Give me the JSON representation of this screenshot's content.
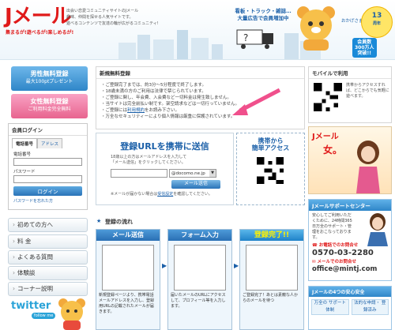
{
  "header": {
    "logo": "Jメール",
    "tagline": "集まるが!遊べるが!楽しめるが!",
    "intro": [
      "出会い恋愛コミュニティサイトのJメール",
      "趣味、仲間を探せる人気サイトです。",
      "遊べるコンテンツで友達の輪が広がるコミュニティ!"
    ],
    "truck_ad": [
      "看板・トラック・雑誌…",
      "大量広告で会員増加中"
    ],
    "badge_pre": "おかげさまで",
    "badge_years": "13",
    "badge_unit": "周年",
    "badge_users": [
      "会員数",
      "300万人",
      "突破!!"
    ]
  },
  "left": {
    "male": {
      "title": "男性無料登録",
      "sub": "最大100ptプレゼント"
    },
    "female": {
      "title": "女性無料登録",
      "sub": "ご利用料金完全無料"
    },
    "login": {
      "title": "会員ログイン",
      "tab_phone": "電話番号",
      "tab_address": "アドレス",
      "phone_label": "電話番号",
      "password_label": "パスワード",
      "button": "ログイン",
      "forgot": "パスワードを忘れた方"
    },
    "menu": [
      "初めての方へ",
      "料 金",
      "よくある質問",
      "体験談",
      "コーナー説明"
    ],
    "twitter": "twitter",
    "twitter_follow": "follow me"
  },
  "main": {
    "news_title": "新規無料登録",
    "news": [
      "・ご登録完了までは、約3分〜5分程度で終了します。",
      "・18歳未満の方のご利用は法律で禁じられています。",
      "・ご登録に関し、年会費、入会費など一切料金は発生致しません。",
      "・当サイトは完全前払い制です。架空請求などは一切行っていません。",
      "・ご登録には",
      "利用規約",
      "をお読み下さい。",
      "・万全なセキュリティーにより個人情報は厳重に保護されています。"
    ],
    "url_box": {
      "title": "登録URLを携帯に送信",
      "desc1": "18歳以上の方はメールアドレスを入力して",
      "desc2": "「メール送信」をクリックしてください。",
      "domain": "@docomo.ne.jp",
      "send": "メール送信",
      "note1": "※メールが届かない場合は",
      "note_link": "受信設定",
      "note2": "を確認してください。"
    },
    "mobile_access": [
      "携帯から",
      "簡単アクセス"
    ],
    "flow": {
      "title": "登録の流れ",
      "steps": [
        {
          "title": "メール送信",
          "text": "新規登録ページより、携帯電話メールアドレスを入力し、登録用URLの記載されたメールが届きます。"
        },
        {
          "title": "フォーム入力",
          "text": "届いたメールのURLにアクセスして、プロフィール等を入力します。"
        },
        {
          "title": "登録完了!!",
          "text": "ご登録完了！あとは素敵な人からのメールを待つ"
        }
      ]
    }
  },
  "right": {
    "mobile_title": "モバイルで利用",
    "mobile_text": "携帯からアクセスすれば、どこからでも気軽に遊べます。",
    "banner_logo": "Jメール",
    "banner_big": "女。",
    "support": {
      "title": "Jメールサポートセンター",
      "text": "安心してご利用いただくために、24時間365日万全のサポート・管理をおこなっております。",
      "phone_label": "お電話でのお問合せ",
      "phone": "0570-03-2280",
      "email_label": "メールでのお問合せ",
      "email": "office@mintj.com"
    },
    "safety": {
      "title": "Jメールの4つの安心安全",
      "items": [
        "万全の サポート体制",
        "法的な申請・ 登録済み"
      ]
    }
  }
}
